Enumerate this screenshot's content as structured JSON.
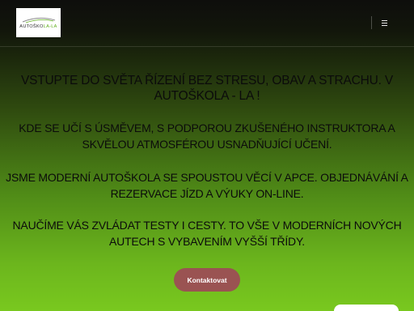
{
  "header": {
    "logo": {
      "text_main": "AUTOŠKO",
      "text_accent": "LA-LA",
      "accent_color": "#5fae1c"
    },
    "menu_icon": "hamburger-menu-icon"
  },
  "main": {
    "heading": "Vstupte do světa řízení bez stresu, obav a strachu. V autoškola - LA !",
    "paragraphs": [
      "Kde se učí s úsměvem, s podporou zkušeného instruktora a skvělou atmosférou usnadňující učení.",
      "Jsme moderní autoškola se spoustou věcí v apce. Objednávání a rezervace jízd a výuky on-line.",
      "Naučíme vás zvládat testy i cesty. To vše v moderních nových autech s vybavením vyšší třídy."
    ],
    "cta_label": "Kontaktovat"
  },
  "colors": {
    "cta_bg": "#9a5352",
    "gradient_top": "#0e0e0c",
    "gradient_bottom": "#79c81f"
  }
}
